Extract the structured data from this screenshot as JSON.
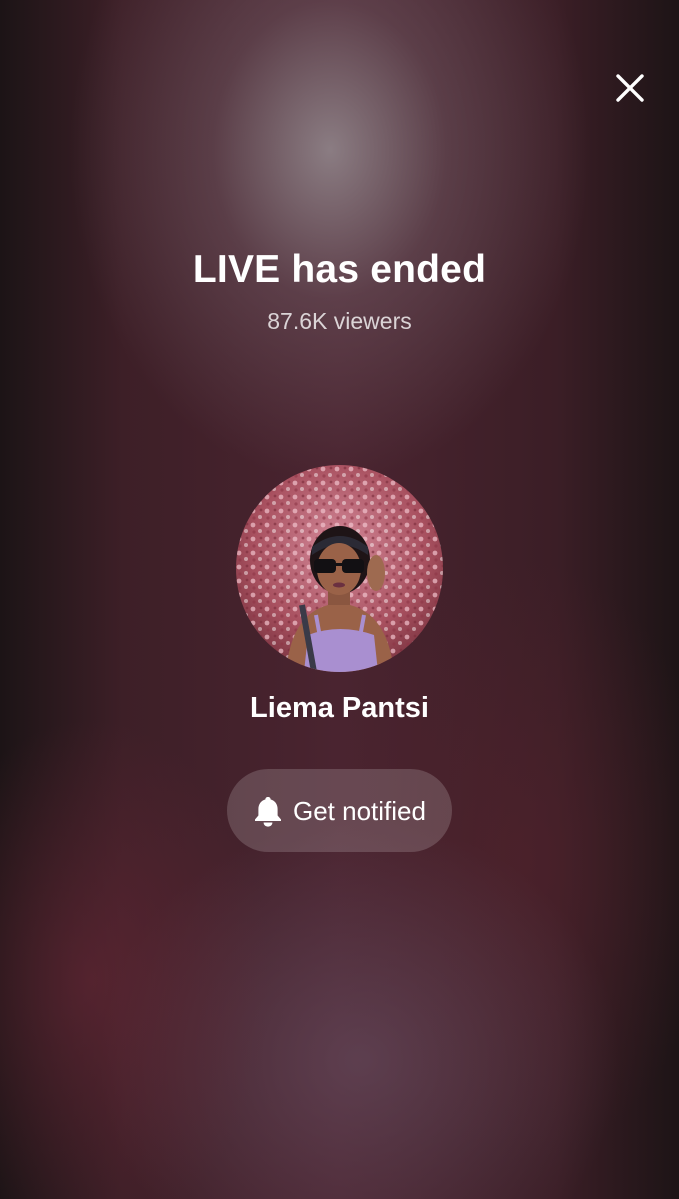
{
  "header": {
    "close_icon": "close-icon"
  },
  "live": {
    "title": "LIVE has ended",
    "viewers": "87.6K viewers"
  },
  "host": {
    "name": "Liema Pantsi",
    "avatar": "avatar-photo"
  },
  "actions": {
    "notify_label": "Get notified",
    "notify_icon": "bell-icon"
  },
  "colors": {
    "text": "#ffffff",
    "button_bg": "rgba(255,255,255,0.17)",
    "background": "#3d1f27"
  }
}
